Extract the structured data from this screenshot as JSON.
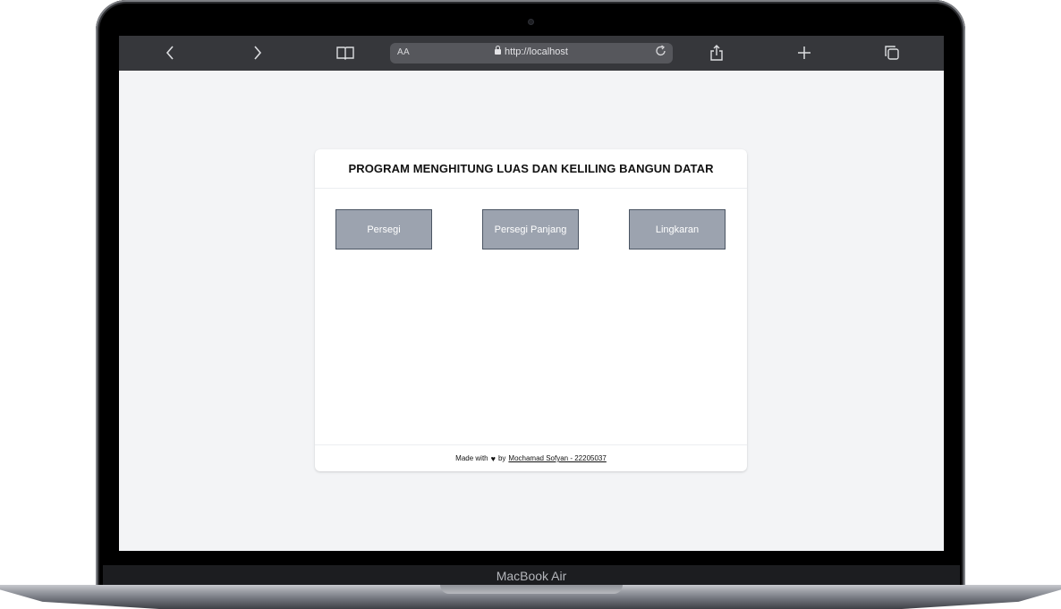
{
  "device": {
    "label": "MacBook Air"
  },
  "browser": {
    "text_size_label": "AA",
    "url": "http://localhost",
    "icons": {
      "back": "chevron-left-icon",
      "forward": "chevron-right-icon",
      "bookmarks": "book-icon",
      "lock": "lock-icon",
      "reload": "reload-icon",
      "share": "share-icon",
      "new_tab": "plus-icon",
      "tabs": "tabs-icon"
    }
  },
  "page": {
    "title": "PROGRAM MENGHITUNG LUAS DAN KELILING BANGUN DATAR",
    "buttons": [
      {
        "label": "Persegi"
      },
      {
        "label": "Persegi Panjang"
      },
      {
        "label": "Lingkaran"
      }
    ],
    "footer": {
      "prefix": "Made with",
      "by": "by",
      "author": "Mochamad Sofyan - 22205037"
    },
    "colors": {
      "button_bg": "#9ca3af",
      "button_border": "#4b5563",
      "page_bg": "#f3f4f6"
    }
  }
}
